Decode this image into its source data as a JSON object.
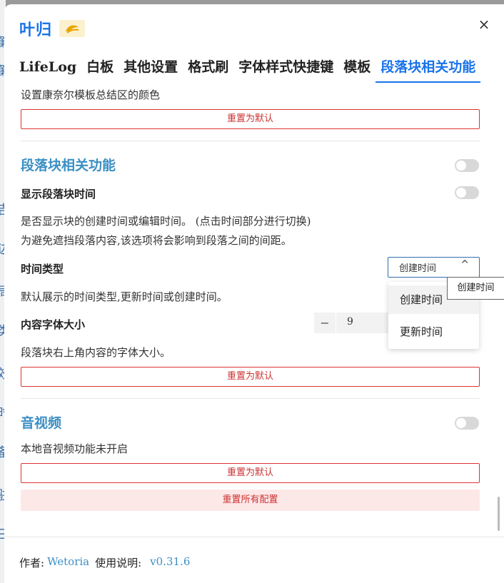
{
  "dialog": {
    "title": "叶归",
    "logo": "leaf-logo",
    "close_glyph": "×"
  },
  "tabs": [
    {
      "label": "LifeLog",
      "active": false
    },
    {
      "label": "白板",
      "active": false
    },
    {
      "label": "其他设置",
      "active": false
    },
    {
      "label": "格式刷",
      "active": false
    },
    {
      "label": "字体样式快捷键",
      "active": false
    },
    {
      "label": "模板",
      "active": false
    },
    {
      "label": "段落块相关功能",
      "active": true
    }
  ],
  "cornell": {
    "description": "设置康奈尔模板总结区的颜色",
    "reset_label": "重置为默认"
  },
  "paragraph": {
    "heading": "段落块相关功能",
    "show_time_label": "显示段落块时间",
    "show_time_desc_1": "是否显示块的创建时间或编辑时间。 (点击时间部分进行切换)",
    "show_time_desc_2": "为避免遮挡段落内容,该选项将会影响到段落之间的间距。",
    "time_type_label": "时间类型",
    "time_type_value": "创建时间",
    "time_type_desc": "默认展示的时间类型,更新时间或创建时间。",
    "font_size_label": "内容字体大小",
    "font_size_value": "9",
    "font_size_desc": "段落块右上角内容的字体大小。",
    "reset_label": "重置为默认",
    "dropdown_options": [
      "创建时间",
      "更新时间"
    ],
    "tooltip": "创建时间"
  },
  "av": {
    "heading": "音视频",
    "desc": "本地音视频功能未开启",
    "reset_label": "重置为默认"
  },
  "reset_all_label": "重置所有配置",
  "footer": {
    "author_label": "作者:",
    "author": "Wetoria",
    "guide": "使用说明:",
    "version": "v0.31.6"
  },
  "backdrop_chars": [
    "簾",
    "簾",
    "吉",
    "边",
    "局",
    "类",
    "效",
    "时",
    "备",
    "驻",
    "三"
  ],
  "colors": {
    "accent": "#1a73e8",
    "heading": "#3b8fc4",
    "danger": "#cc3333"
  }
}
